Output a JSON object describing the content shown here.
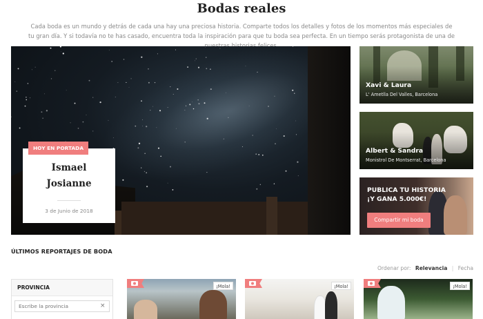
{
  "page": {
    "title": "Bodas reales",
    "intro": "Cada boda es un mundo y detrás de cada una hay una preciosa historia. Comparte todos los detalles y fotos de los momentos más especiales de tu gran día. Y si todavía no te has casado, encuentra toda la inspiración para que tu boda sea perfecta. En un tiempo serás protagonista de una de nuestras historias felices."
  },
  "featured": {
    "badge": "HOY EN PORTADA",
    "name_line1": "Ismael",
    "name_line2": "Josianne",
    "date": "3 de Junio de 2018"
  },
  "side_tiles": [
    {
      "names": "Xavi & Laura",
      "location": "L' Ametlla Del Valles, Barcelona"
    },
    {
      "names": "Albert & Sandra",
      "location": "Monistrol De Montserrat, Barcelona"
    }
  ],
  "promo": {
    "line1": "PUBLICA TU HISTORIA",
    "line2": "¡Y GANA 5.000€!",
    "button": "Compartir mi boda"
  },
  "latest": {
    "title": "ÚLTIMOS REPORTAJES DE BODA",
    "sort_label": "Ordenar por:",
    "sort_options": [
      "Relevancia",
      "Fecha"
    ],
    "sort_active": "Relevancia"
  },
  "filter": {
    "heading": "PROVINCIA",
    "placeholder": "Escribe la provincia",
    "clear_icon": "×"
  },
  "cards": [
    {
      "badge": "¡Mola!",
      "icon": "camera-icon"
    },
    {
      "badge": "¡Mola!",
      "icon": "camera-icon"
    },
    {
      "badge": "¡Mola!",
      "icon": "camera-icon"
    }
  ],
  "colors": {
    "accent": "#f07e7e",
    "text_dark": "#222222",
    "text_muted": "#8a8a8a"
  }
}
